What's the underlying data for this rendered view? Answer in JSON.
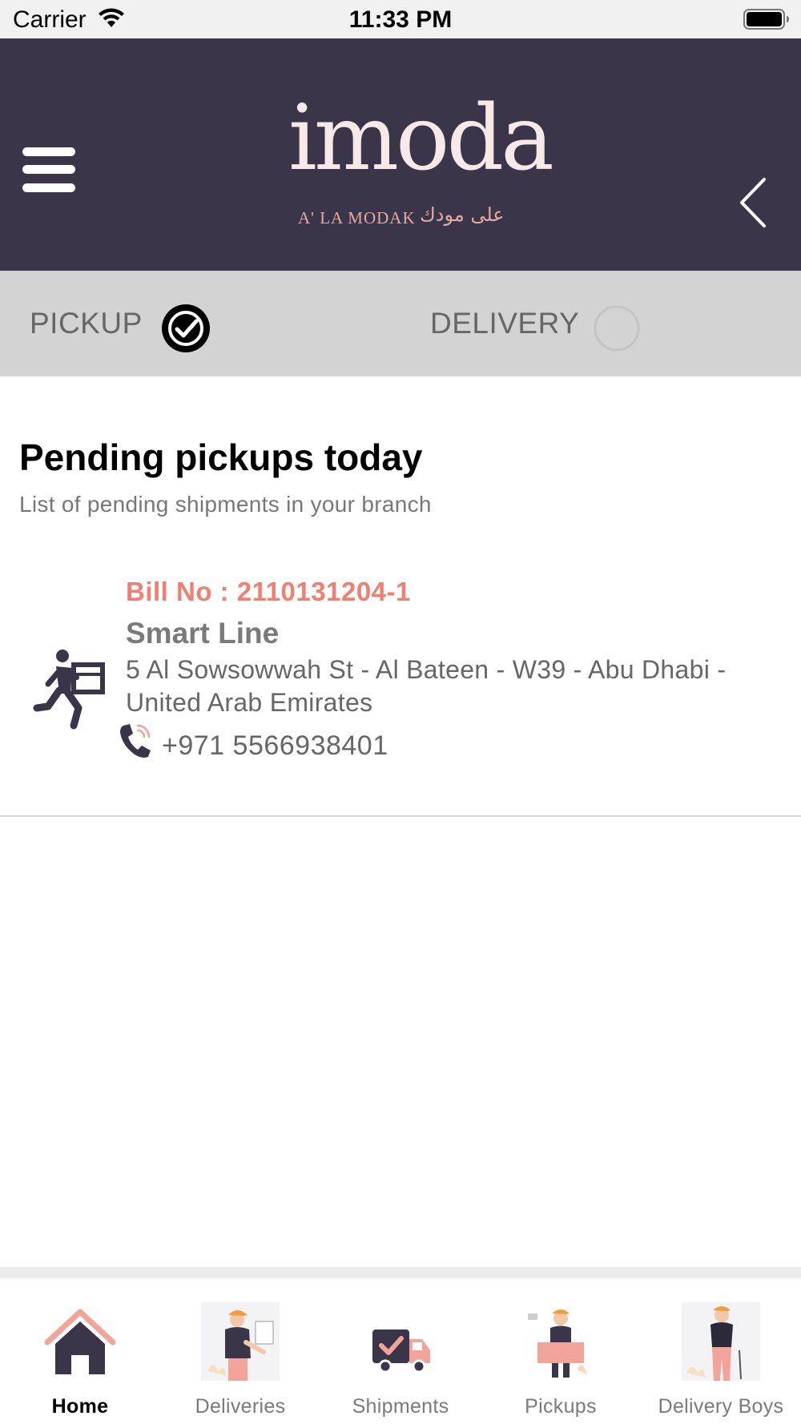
{
  "status_bar": {
    "carrier": "Carrier",
    "time": "11:33 PM"
  },
  "header": {
    "logo_text": "imoda",
    "logo_tagline": "A' LA MODAK",
    "logo_arabic": "على مودك",
    "menu_icon": "hamburger-icon",
    "back_icon": "chevron-left-icon"
  },
  "segment": {
    "pickup_label": "PICKUP",
    "delivery_label": "DELIVERY",
    "selected": "pickup"
  },
  "main": {
    "title": "Pending pickups today",
    "subtitle": "List of pending shipments in your branch",
    "pickups": [
      {
        "bill_no": "Bill No : 2110131204-1",
        "company": "Smart Line",
        "address": "5 Al Sowsowwah St - Al Bateen - W39 - Abu Dhabi - United Arab Emirates",
        "phone": "+971 5566938401"
      }
    ]
  },
  "tabbar": {
    "items": [
      {
        "label": "Home",
        "icon": "home-icon",
        "active": true
      },
      {
        "label": "Deliveries",
        "icon": "delivery-person-icon",
        "active": false
      },
      {
        "label": "Shipments",
        "icon": "truck-icon",
        "active": false
      },
      {
        "label": "Pickups",
        "icon": "pickup-person-icon",
        "active": false
      },
      {
        "label": "Delivery Boys",
        "icon": "delivery-boy-icon",
        "active": false
      }
    ]
  },
  "colors": {
    "header_bg": "#3a3549",
    "accent": "#f07f72",
    "segment_bg": "#d3d3d3",
    "icon_dark": "#3a3549",
    "icon_pink": "#f2a39a"
  }
}
